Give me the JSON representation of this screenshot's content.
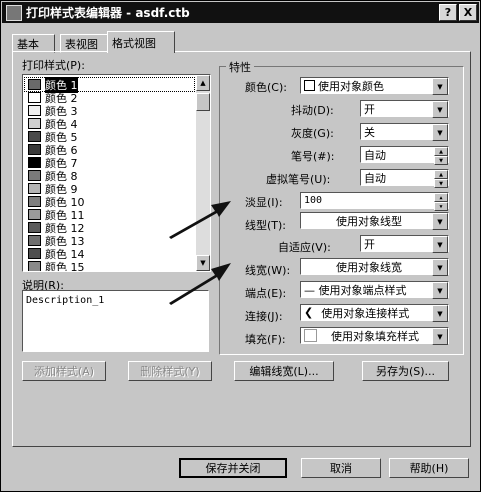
{
  "window": {
    "title": "打印样式表编辑器 - asdf.ctb",
    "help_btn": "?",
    "close_btn": "X"
  },
  "tabs": [
    {
      "label": "基本"
    },
    {
      "label": "表视图"
    },
    {
      "label": "格式视图"
    }
  ],
  "left": {
    "styles_label": "打印样式(P):",
    "styles": [
      {
        "label": "颜色 1",
        "color": "#6a6a6a"
      },
      {
        "label": "颜色 2",
        "color": "#ffffff"
      },
      {
        "label": "颜色 3",
        "color": "#f0f0f0"
      },
      {
        "label": "颜色 4",
        "color": "#d0d0d0"
      },
      {
        "label": "颜色 5",
        "color": "#4a4a4a"
      },
      {
        "label": "颜色 6",
        "color": "#3a3a3a"
      },
      {
        "label": "颜色 7",
        "color": "#000000"
      },
      {
        "label": "颜色 8",
        "color": "#7a7a7a"
      },
      {
        "label": "颜色 9",
        "color": "#b5b5b5"
      },
      {
        "label": "颜色 10",
        "color": "#7e7e7e"
      },
      {
        "label": "颜色 11",
        "color": "#9a9a9a"
      },
      {
        "label": "颜色 12",
        "color": "#5a5a5a"
      },
      {
        "label": "颜色 13",
        "color": "#6e6e6e"
      },
      {
        "label": "颜色 14",
        "color": "#4e4e4e"
      },
      {
        "label": "颜色 15",
        "color": "#8a8a8a"
      }
    ],
    "desc_label": "说明(R):",
    "desc_value": "Description_1"
  },
  "props": {
    "group_label": "特性",
    "color_label": "颜色(C):",
    "color_value": "使用对象颜色",
    "dither_label": "抖动(D):",
    "dither_value": "开",
    "gray_label": "灰度(G):",
    "gray_value": "关",
    "pen_label": "笔号(#):",
    "pen_value": "自动",
    "vpen_label": "虚拟笔号(U):",
    "vpen_value": "自动",
    "screen_label": "淡显(I):",
    "screen_value": "100",
    "linetype_label": "线型(T):",
    "linetype_value": "使用对象线型",
    "adaptive_label": "自适应(V):",
    "adaptive_value": "开",
    "lineweight_label": "线宽(W):",
    "lineweight_value": "使用对象线宽",
    "endstyle_label": "端点(E):",
    "endstyle_value": "— 使用对象端点样式",
    "joinstyle_label": "连接(J):",
    "joinstyle_value": "使用对象连接样式",
    "fill_label": "填充(F):",
    "fill_value": "使用对象填充样式"
  },
  "buttons": {
    "add_style": "添加样式(A)",
    "delete_style": "删除样式(Y)",
    "edit_lineweights": "编辑线宽(L)...",
    "save_as": "另存为(S)...",
    "save_close": "保存并关闭",
    "cancel": "取消",
    "help": "帮助(H)"
  }
}
